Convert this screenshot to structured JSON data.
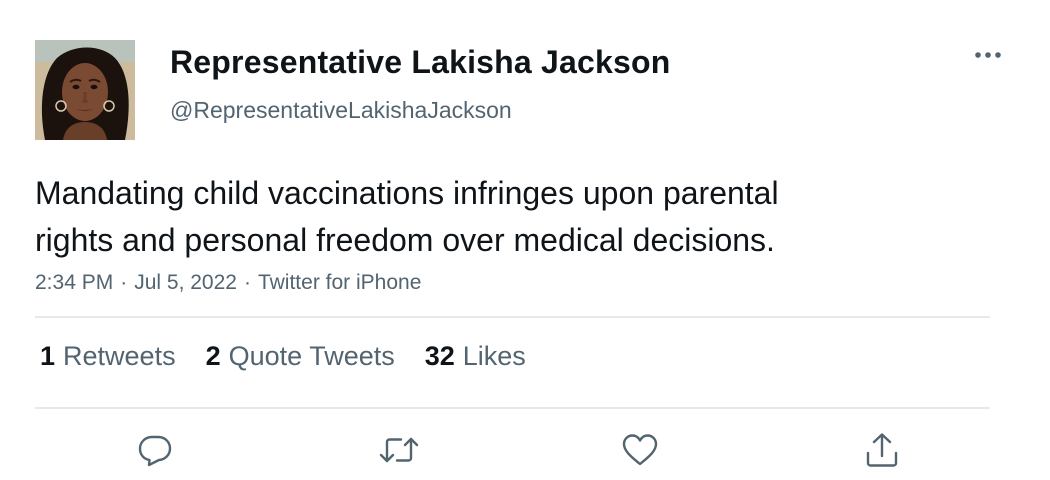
{
  "user": {
    "display_name": "Representative Lakisha Jackson",
    "handle": "@RepresentativeLakishaJackson",
    "avatar_icon": "profile-photo"
  },
  "tweet": {
    "text": "Mandating child vaccinations infringes upon parental\nrights and personal freedom over medical decisions.",
    "time": "2:34 PM",
    "separator": "·",
    "date": "Jul 5, 2022",
    "source": "Twitter for iPhone"
  },
  "stats": {
    "retweets_count": "1",
    "retweets_label": "Retweets",
    "quotes_count": "2",
    "quotes_label": "Quote Tweets",
    "likes_count": "32",
    "likes_label": "Likes"
  },
  "actions": {
    "icons": [
      "reply-icon",
      "retweet-icon",
      "like-icon",
      "share-icon"
    ]
  },
  "colors": {
    "text_primary": "#0f1419",
    "text_secondary": "#536471",
    "icon_gray": "#536471",
    "divider": "#e6e8ea",
    "background": "#ffffff"
  }
}
